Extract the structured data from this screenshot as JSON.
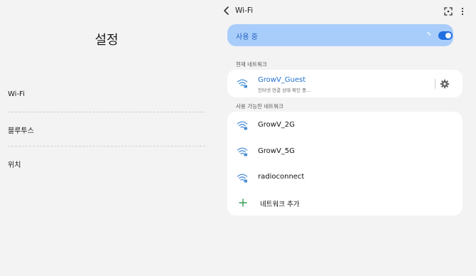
{
  "left": {
    "title": "설정",
    "items": [
      {
        "label": "Wi-Fi"
      },
      {
        "label": "블루투스"
      },
      {
        "label": "위치"
      }
    ]
  },
  "wifi": {
    "title": "Wi-Fi",
    "usage_label": "사용 중",
    "toggle_on": true,
    "current_section": "현재 네트워크",
    "current_network": {
      "name": "GrowV_Guest",
      "status": "인터넷 연결 상태 확인 중..."
    },
    "available_section": "사용 가능한 네트워크",
    "available_networks": [
      {
        "name": "GrowV_2G"
      },
      {
        "name": "GrowV_5G"
      },
      {
        "name": "radioconnect"
      }
    ],
    "add_network_label": "네트워크 추가"
  },
  "colors": {
    "accent": "#1f6fe0",
    "usage_bg": "#a9cdfb",
    "active_text": "#1f6fcf",
    "plus_green": "#2e9e4f",
    "wifi_icon": "#4a8fd6"
  },
  "icons": {
    "back": "chevron-left-icon",
    "expand": "expand-icon",
    "more": "more-vertical-icon",
    "wifi": "wifi-lock-icon",
    "settings": "gear-icon",
    "add": "plus-icon"
  }
}
